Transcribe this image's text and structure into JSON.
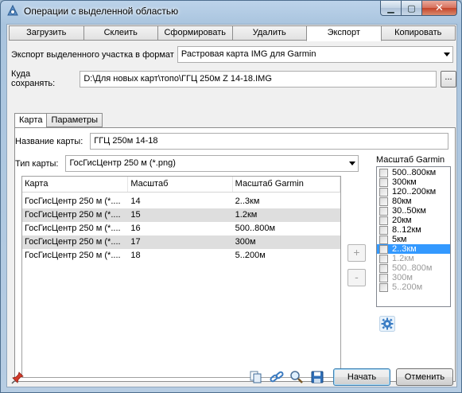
{
  "window": {
    "title": "Операции с выделенной областью"
  },
  "caption": {
    "minimize": "▁",
    "maximize": "▢",
    "close": "✕"
  },
  "tabs": [
    "Загрузить",
    "Склеить",
    "Сформировать",
    "Удалить",
    "Экспорт",
    "Копировать"
  ],
  "active_tab": "Экспорт",
  "export": {
    "format_label": "Экспорт выделенного участка в формат",
    "format_value": "Растровая карта IMG для Garmin",
    "save_label": "Куда сохранять:",
    "save_path": "D:\\Для новых карт\\топо\\ГГЦ 250м Z 14-18.IMG",
    "browse_label": "..."
  },
  "subtabs": [
    "Карта",
    "Параметры"
  ],
  "map": {
    "name_label": "Название карты:",
    "name_value": "ГГЦ 250м 14-18",
    "type_label": "Тип карты:",
    "type_value": "ГосГисЦентр 250 м (*.png)"
  },
  "table": {
    "columns": [
      "Карта",
      "Масштаб",
      "Масштаб Garmin"
    ],
    "rows": [
      [
        "ГосГисЦентр 250 м (*....",
        "14",
        "2..3км"
      ],
      [
        "ГосГисЦентр 250 м (*....",
        "15",
        "1.2км"
      ],
      [
        "ГосГисЦентр 250 м (*....",
        "16",
        "500..800м"
      ],
      [
        "ГосГисЦентр 250 м (*....",
        "17",
        "300м"
      ],
      [
        "ГосГисЦентр 250 м (*....",
        "18",
        "5..200м"
      ]
    ]
  },
  "side_buttons": {
    "add": "+",
    "remove": "-"
  },
  "garmin": {
    "label": "Масштаб Garmin",
    "items": [
      {
        "label": "500..800км",
        "state": "normal"
      },
      {
        "label": "300км",
        "state": "normal"
      },
      {
        "label": "120..200км",
        "state": "normal"
      },
      {
        "label": "80км",
        "state": "normal"
      },
      {
        "label": "30..50км",
        "state": "normal"
      },
      {
        "label": "20км",
        "state": "normal"
      },
      {
        "label": "8..12км",
        "state": "normal"
      },
      {
        "label": "5км",
        "state": "normal"
      },
      {
        "label": "2..3км",
        "state": "selected"
      },
      {
        "label": "1.2км",
        "state": "disabled"
      },
      {
        "label": "500..800м",
        "state": "disabled"
      },
      {
        "label": "300м",
        "state": "disabled"
      },
      {
        "label": "5..200м",
        "state": "disabled"
      }
    ]
  },
  "buttons": {
    "start": "Начать",
    "cancel": "Отменить"
  },
  "colors": {
    "selection": "#3399ff",
    "titlebar": "#b7cde3",
    "close": "#c4442a"
  }
}
